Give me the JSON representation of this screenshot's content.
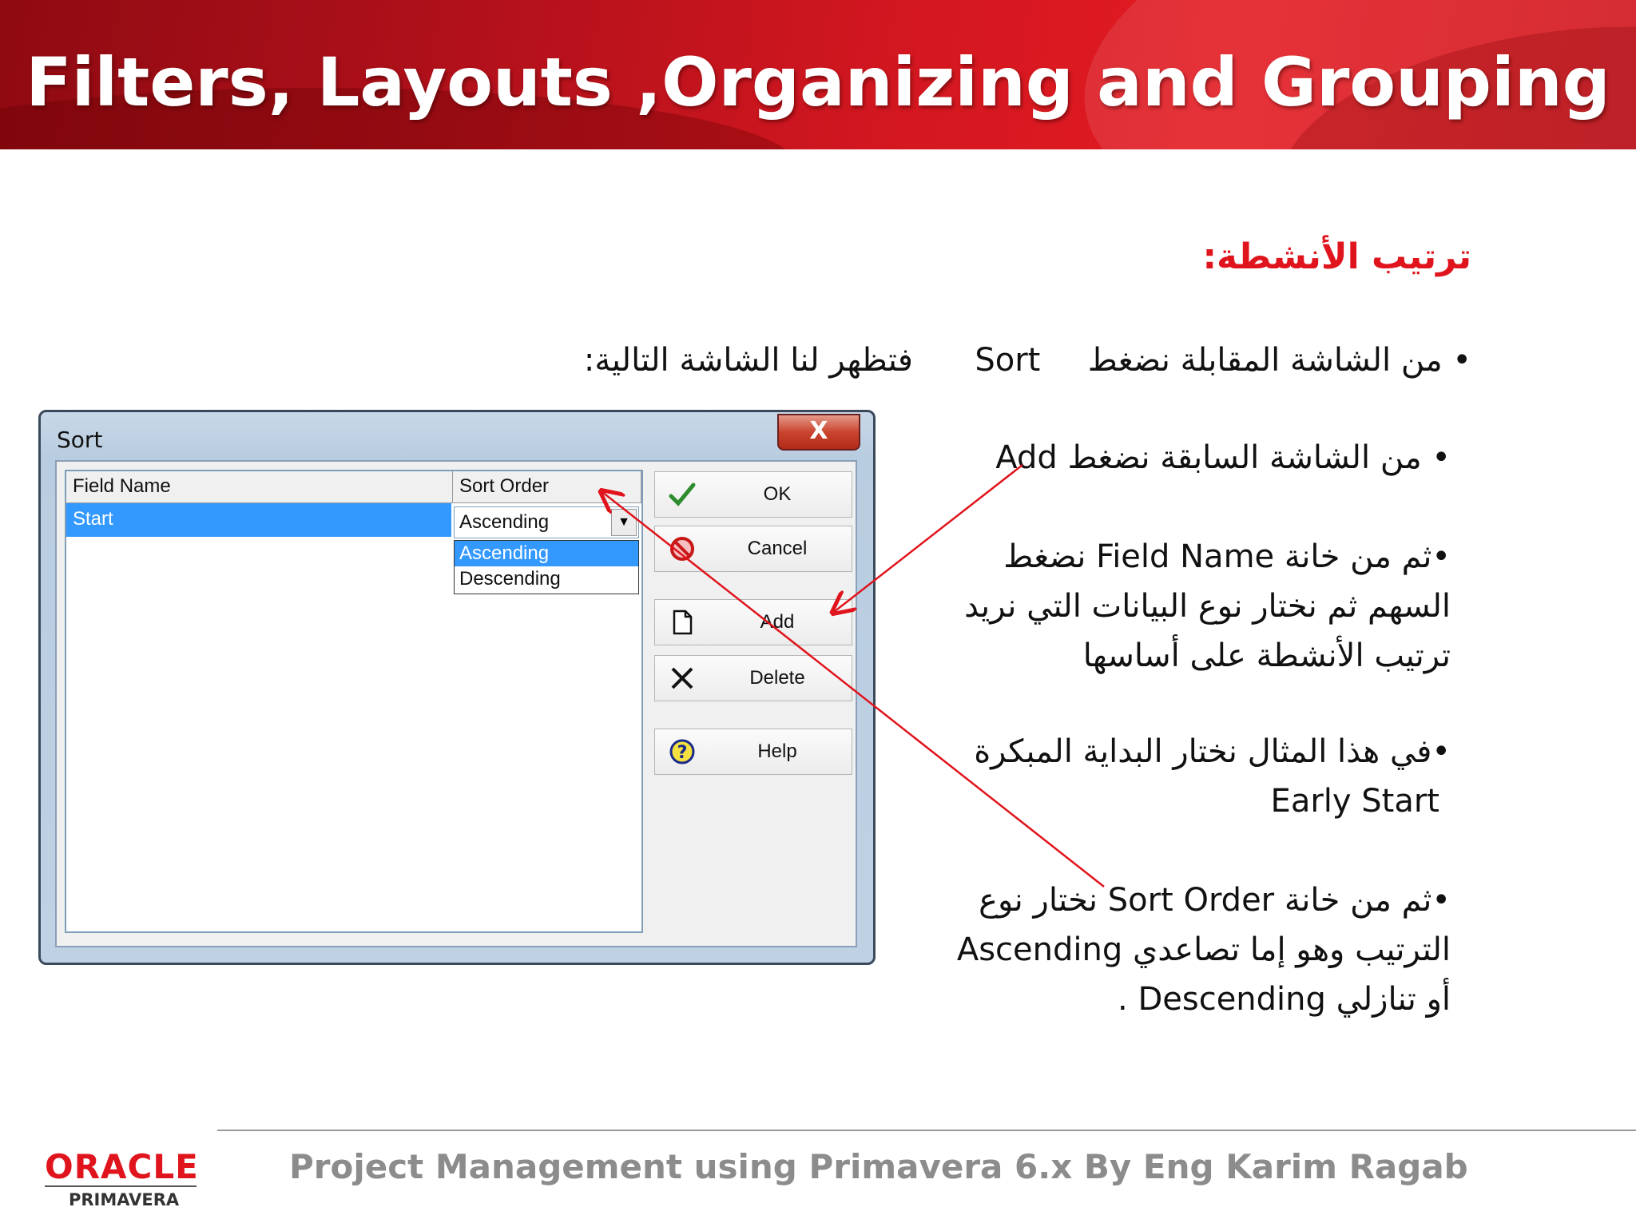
{
  "slide": {
    "title": "Filters, Layouts ,Organizing and Grouping",
    "heading": "ترتيب الأنشطة:",
    "line1_a": "من الشاشة المقابلة نضغط",
    "line1_sort": "Sort",
    "line1_b": "فتظهر لنا الشاشة التالية:",
    "bullet_add": "من الشاشة السابقة نضغط Add",
    "bullet_field_1": "ثم من خانة Field Name نضغط",
    "bullet_field_2": "السهم ثم نختار نوع البيانات التي نريد",
    "bullet_field_3": "ترتيب الأنشطة على أساسها",
    "bullet_example_1": "في هذا المثال نختار البداية المبكرة",
    "bullet_example_2": "Early Start",
    "bullet_order_1": "ثم من خانة Sort Order نختار نوع",
    "bullet_order_2": "الترتيب وهو إما تصاعدي Ascending",
    "bullet_order_3": "أو تنازلي Descending ."
  },
  "dialog": {
    "title": "Sort",
    "close": "X",
    "columns": {
      "field": "Field Name",
      "order": "Sort Order"
    },
    "row_field": "Start",
    "combo_value": "Ascending",
    "options": [
      "Ascending",
      "Descending"
    ],
    "buttons": {
      "ok": "OK",
      "cancel": "Cancel",
      "add": "Add",
      "delete": "Delete",
      "help": "Help"
    }
  },
  "footer": {
    "text": "Project Management using Primavera 6.x By Eng Karim Ragab",
    "logo": "ORACLE",
    "logo_sub": "PRIMAVERA"
  },
  "colors": {
    "banner": "#d31720",
    "heading": "#e0141c",
    "selection": "#3399ff",
    "arrow": "#e0141c"
  }
}
